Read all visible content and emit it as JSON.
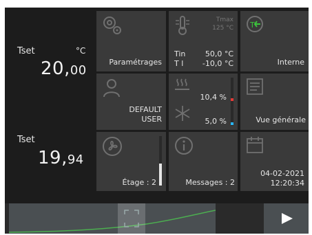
{
  "left": {
    "tset_label": "Tset",
    "tset_unit": "°C",
    "tset_int": "20,",
    "tset_dec": "00",
    "tist_label": "Tset",
    "tist_int": "19,",
    "tist_dec": "94"
  },
  "tiles": {
    "settings": {
      "label": "Paramétrages",
      "icon": "gears-icon"
    },
    "temperature": {
      "icon": "thermometer-icon",
      "tmax_label": "Tmax",
      "tmax_value": "125 °C",
      "tin_label": "Tin",
      "tin_value": "50,0 °C",
      "tl_label": "T l",
      "tl_value": "-10,0 °C"
    },
    "mode": {
      "label": "Interne",
      "icon": "internal-mode-icon"
    },
    "user": {
      "label_line1": "DEFAULT",
      "label_line2": "USER",
      "icon": "user-icon"
    },
    "climate": {
      "heat_icon": "heat-icon",
      "cool_icon": "snowflake-icon",
      "heat_value": "10,4 %",
      "cool_value": "5,0 %",
      "heat_color": "#e53935",
      "cool_color": "#29b6f6"
    },
    "overview": {
      "label": "Vue générale",
      "icon": "list-icon"
    },
    "fan": {
      "label": "Étage : 2",
      "icon": "fan-icon",
      "level_fraction": 0.45
    },
    "messages": {
      "label": "Messages : 2",
      "icon": "info-icon"
    },
    "datetime": {
      "date": "04-02-2021",
      "time": "12:20:34",
      "icon": "calendar-icon"
    }
  },
  "bottom": {
    "play_icon": "play-icon",
    "expand_icon": "expand-icon",
    "trend_color": "#4caf50"
  }
}
